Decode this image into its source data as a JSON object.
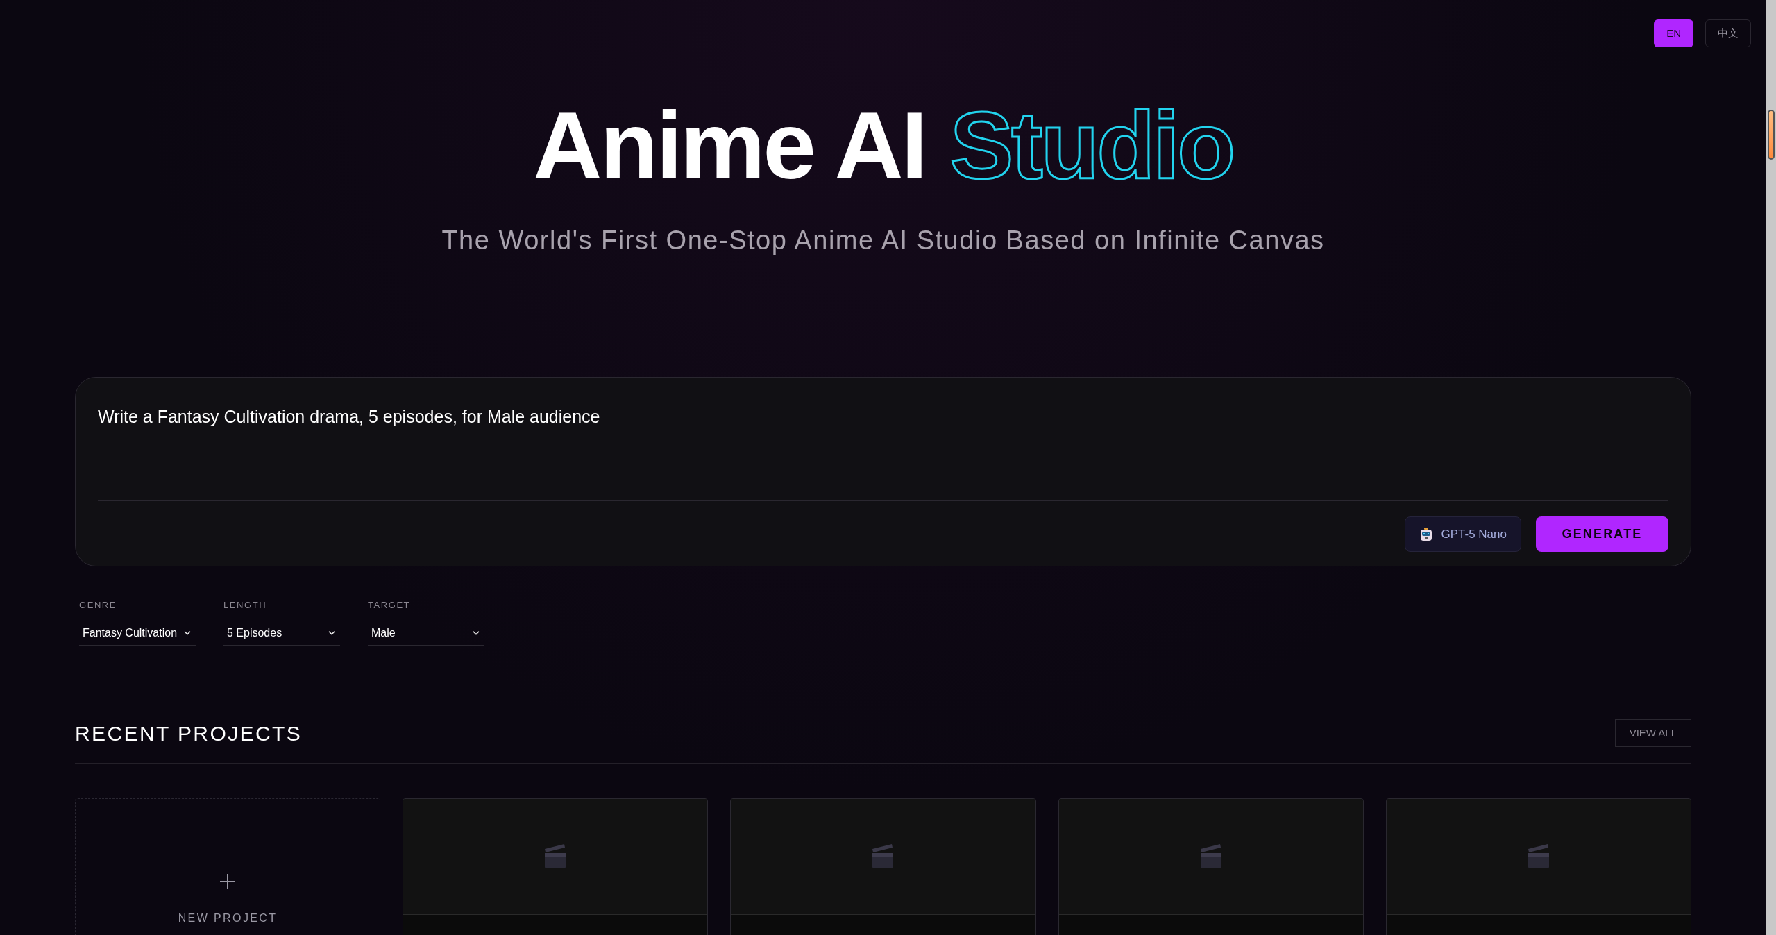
{
  "language_switch": [
    {
      "label": "EN",
      "selected": true
    },
    {
      "label": "中文",
      "selected": false
    }
  ],
  "hero": {
    "title": "Anime AI",
    "title_accent": "Studio",
    "subtitle": "The World's First One-Stop Anime AI Studio Based on Infinite Canvas"
  },
  "prompt": {
    "value": "Write a Fantasy Cultivation drama, 5 episodes, for Male audience",
    "model": "GPT-5 Nano",
    "button": "GENERATE"
  },
  "filters": [
    {
      "label": "GENRE",
      "value": "Fantasy Cultivation"
    },
    {
      "label": "LENGTH",
      "value": "5 Episodes"
    },
    {
      "label": "TARGET",
      "value": "Male"
    }
  ],
  "recent_projects": {
    "title": "RECENT PROJECTS",
    "view_all": "VIEW ALL",
    "cards": [
      {
        "kind": "new",
        "label": "NEW PROJECT"
      },
      {
        "kind": "project"
      },
      {
        "kind": "project"
      },
      {
        "kind": "project"
      },
      {
        "kind": "project"
      }
    ]
  }
}
